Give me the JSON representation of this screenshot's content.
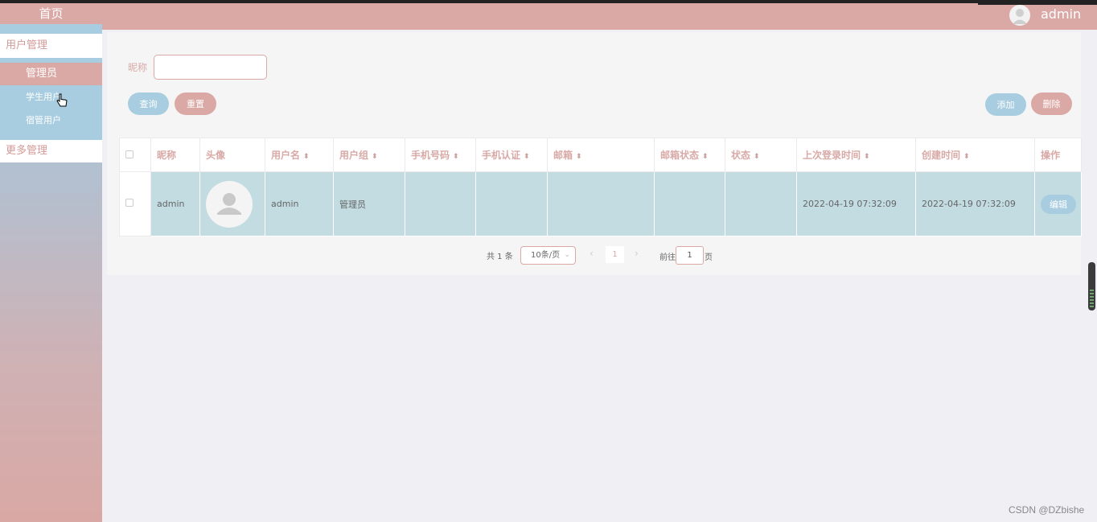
{
  "header": {
    "user": "admin"
  },
  "sidebar": {
    "home": "首页",
    "groups": [
      {
        "label": "用户管理",
        "items": [
          "管理员",
          "学生用户",
          "宿管用户"
        ]
      },
      {
        "label": "更多管理"
      }
    ]
  },
  "search": {
    "label": "昵称",
    "value": ""
  },
  "buttons": {
    "query": "查询",
    "reset": "重置",
    "add": "添加",
    "delete": "删除"
  },
  "table": {
    "columns": [
      "昵称",
      "头像",
      "用户名",
      "用户组",
      "手机号码",
      "手机认证",
      "邮箱",
      "邮箱状态",
      "状态",
      "上次登录时间",
      "创建时间",
      "操作"
    ],
    "rows": [
      {
        "nickname": "admin",
        "username": "admin",
        "group": "管理员",
        "phone": "",
        "phone_verified": "",
        "email": "",
        "email_status": "",
        "status": "",
        "last_login": "2022-04-19 07:32:09",
        "created": "2022-04-19 07:32:09",
        "action": "编辑"
      }
    ]
  },
  "pagination": {
    "total_text": "共 1 条",
    "page_size": "10条/页",
    "current_page": "1",
    "goto_label": "前往",
    "goto_value": "1",
    "page_label": "页"
  },
  "watermark": "CSDN @DZbishe",
  "colors": {
    "accent_pink": "#dba9a5",
    "accent_blue": "#a8cde0"
  }
}
